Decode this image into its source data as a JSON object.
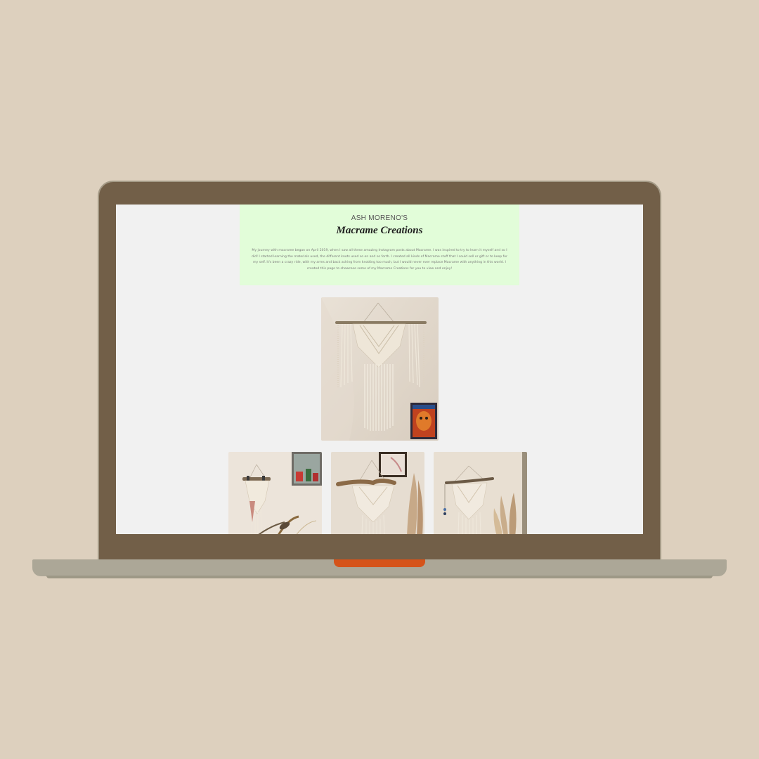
{
  "site": {
    "kicker": "ASH MORENO'S",
    "title": "Macrame Creations",
    "intro": "My journey with macrame began on April 2019, when I saw all these amazing Instagram posts about Macrame. I was inspired to try to learn it myself and so I did! I started learning the materials used, the different knots used so on and so forth. I created all kinds of Macrame stuff that I could sell or gift or to keep for my self. It's been a crazy ride, with my arms and back aching from knotting too much, but I would never ever replace Macrame with anything in this world. I created this page to showcase some of my Macrame Creations for you to view and enjoy!"
  },
  "gallery": {
    "featured": {
      "icon": "macrame-wall-hanging-photo"
    },
    "thumbnails": [
      {
        "icon": "macrame-hanging-with-feathers-photo"
      },
      {
        "icon": "macrame-hanging-driftwood-photo"
      },
      {
        "icon": "macrame-hanging-pampas-photo"
      }
    ]
  },
  "colors": {
    "background": "#ddd0be",
    "laptop_lid": "#725f48",
    "laptop_base": "#aca797",
    "notch_accent": "#d5531a",
    "screen_bg": "#f1f1f1",
    "hero_bg": "#e2fdd9"
  }
}
